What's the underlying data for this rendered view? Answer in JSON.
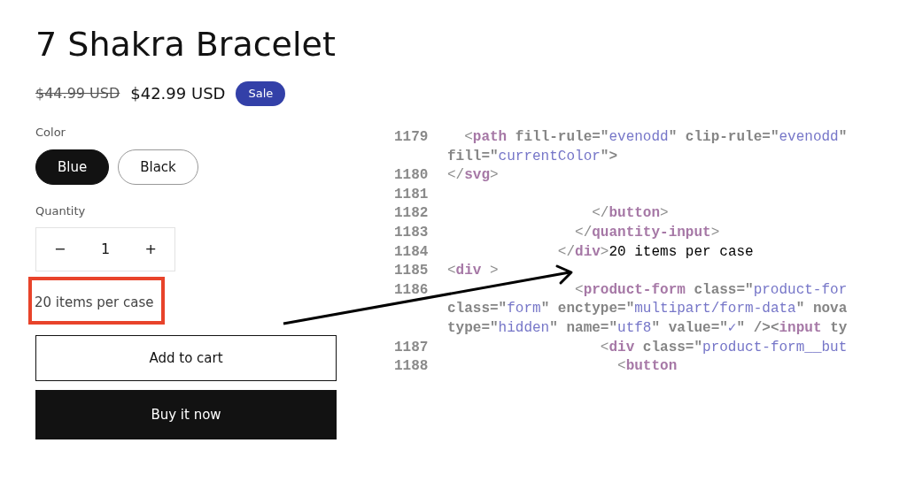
{
  "product": {
    "title": "7 Shakra Bracelet",
    "price_original": "$44.99 USD",
    "price_sale": "$42.99 USD",
    "badge": "Sale",
    "color_label": "Color",
    "colors": [
      {
        "label": "Blue",
        "selected": true
      },
      {
        "label": "Black",
        "selected": false
      }
    ],
    "quantity_label": "Quantity",
    "quantity": {
      "minus": "−",
      "value": "1",
      "plus": "+"
    },
    "note": {
      "text": "20 items per case",
      "highlighted": true
    },
    "buttons": [
      {
        "label": "Add to cart",
        "kind": "outline"
      },
      {
        "label": "Buy it now",
        "kind": "solid"
      }
    ]
  },
  "code": {
    "lines": [
      {
        "number": "1179",
        "tokens": [
          {
            "kind": "punct",
            "text": "  <"
          },
          {
            "kind": "tag",
            "text": "path"
          },
          {
            "kind": "attr",
            "text": " fill-rule=\""
          },
          {
            "kind": "value",
            "text": "evenodd"
          },
          {
            "kind": "attr",
            "text": "\" clip-rule=\""
          },
          {
            "kind": "value",
            "text": "evenodd"
          },
          {
            "kind": "attr",
            "text": "\""
          }
        ]
      },
      {
        "tokens": [
          {
            "kind": "attr",
            "text": "fill=\""
          },
          {
            "kind": "value",
            "text": "currentColor"
          },
          {
            "kind": "attr",
            "text": "\">"
          }
        ]
      },
      {
        "number": "1180",
        "tokens": [
          {
            "kind": "punct",
            "text": "</"
          },
          {
            "kind": "tag",
            "text": "svg"
          },
          {
            "kind": "punct",
            "text": ">"
          }
        ]
      },
      {
        "number": "1181"
      },
      {
        "number": "1182",
        "tokens": [
          {
            "kind": "punct",
            "text": "                 </"
          },
          {
            "kind": "tag",
            "text": "button"
          },
          {
            "kind": "punct",
            "text": ">"
          }
        ]
      },
      {
        "number": "1183",
        "tokens": [
          {
            "kind": "punct",
            "text": "               </"
          },
          {
            "kind": "tag",
            "text": "quantity-input"
          },
          {
            "kind": "punct",
            "text": ">"
          }
        ]
      },
      {
        "number": "1184",
        "tokens": [
          {
            "kind": "punct",
            "text": "             </"
          },
          {
            "kind": "tag",
            "text": "div"
          },
          {
            "kind": "punct",
            "text": ">"
          },
          {
            "kind": "annotation",
            "text": "20 items per case"
          }
        ]
      },
      {
        "number": "1185",
        "tokens": [
          {
            "kind": "punct",
            "text": "<"
          },
          {
            "kind": "tag",
            "text": "div"
          },
          {
            "kind": "punct",
            "text": " >"
          }
        ]
      },
      {
        "number": "1186",
        "tokens": [
          {
            "kind": "punct",
            "text": "               <"
          },
          {
            "kind": "tag",
            "text": "product-form"
          },
          {
            "kind": "attr",
            "text": " class=\""
          },
          {
            "kind": "value",
            "text": "product-for"
          }
        ]
      },
      {
        "tokens": [
          {
            "kind": "attr",
            "text": "class=\""
          },
          {
            "kind": "value",
            "text": "form"
          },
          {
            "kind": "attr",
            "text": "\" enctype=\""
          },
          {
            "kind": "value",
            "text": "multipart/form-data"
          },
          {
            "kind": "attr",
            "text": "\" nova"
          }
        ]
      },
      {
        "tokens": [
          {
            "kind": "attr",
            "text": "type=\""
          },
          {
            "kind": "value",
            "text": "hidden"
          },
          {
            "kind": "attr",
            "text": "\" name=\""
          },
          {
            "kind": "value",
            "text": "utf8"
          },
          {
            "kind": "attr",
            "text": "\" value=\""
          },
          {
            "kind": "value",
            "text": "✓"
          },
          {
            "kind": "attr",
            "text": "\" /><"
          },
          {
            "kind": "tag",
            "text": "input"
          },
          {
            "kind": "attr",
            "text": " ty"
          }
        ]
      },
      {
        "number": "1187",
        "tokens": [
          {
            "kind": "punct",
            "text": "                  <"
          },
          {
            "kind": "tag",
            "text": "div"
          },
          {
            "kind": "attr",
            "text": " class=\""
          },
          {
            "kind": "value",
            "text": "product-form__but"
          }
        ]
      },
      {
        "number": "1188",
        "tokens": [
          {
            "kind": "punct",
            "text": "                    <"
          },
          {
            "kind": "tag",
            "text": "button"
          }
        ]
      }
    ]
  }
}
